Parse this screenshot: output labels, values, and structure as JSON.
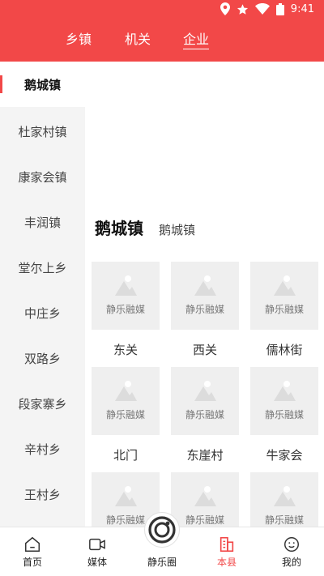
{
  "status_bar": {
    "time": "9:41",
    "icons": [
      "location-icon",
      "star-icon",
      "wifi-icon",
      "battery-icon"
    ]
  },
  "top_tabs": [
    {
      "label": "乡镇"
    },
    {
      "label": "机关"
    },
    {
      "label": "企业"
    }
  ],
  "top_tabs_active": "企业",
  "sidebar": {
    "items": [
      {
        "label": "鹅城镇"
      },
      {
        "label": "杜家村镇"
      },
      {
        "label": "康家会镇"
      },
      {
        "label": "丰润镇"
      },
      {
        "label": "堂尔上乡"
      },
      {
        "label": "中庄乡"
      },
      {
        "label": "双路乡"
      },
      {
        "label": "段家寨乡"
      },
      {
        "label": "辛村乡"
      },
      {
        "label": "王村乡"
      }
    ],
    "active": "鹅城镇"
  },
  "section": {
    "title": "鹅城镇",
    "subtitle": "鹅城镇"
  },
  "grid": {
    "placeholder_text": "静乐融媒",
    "items": [
      {
        "label": "东关"
      },
      {
        "label": "西关"
      },
      {
        "label": "儒林街"
      },
      {
        "label": "北门"
      },
      {
        "label": "东崖村"
      },
      {
        "label": "牛家会"
      },
      {
        "label": ""
      },
      {
        "label": ""
      },
      {
        "label": ""
      }
    ]
  },
  "bottom_nav": {
    "items": [
      {
        "label": "首页",
        "icon": "home-icon"
      },
      {
        "label": "媒体",
        "icon": "video-icon"
      },
      {
        "label": "静乐圈",
        "icon": "circle-icon"
      },
      {
        "label": "本县",
        "icon": "building-icon"
      },
      {
        "label": "我的",
        "icon": "face-icon"
      }
    ],
    "active": "本县"
  },
  "colors": {
    "brand": "#f24848",
    "sidebar_bg": "#f4f4f4",
    "thumb_bg": "#efefef"
  }
}
